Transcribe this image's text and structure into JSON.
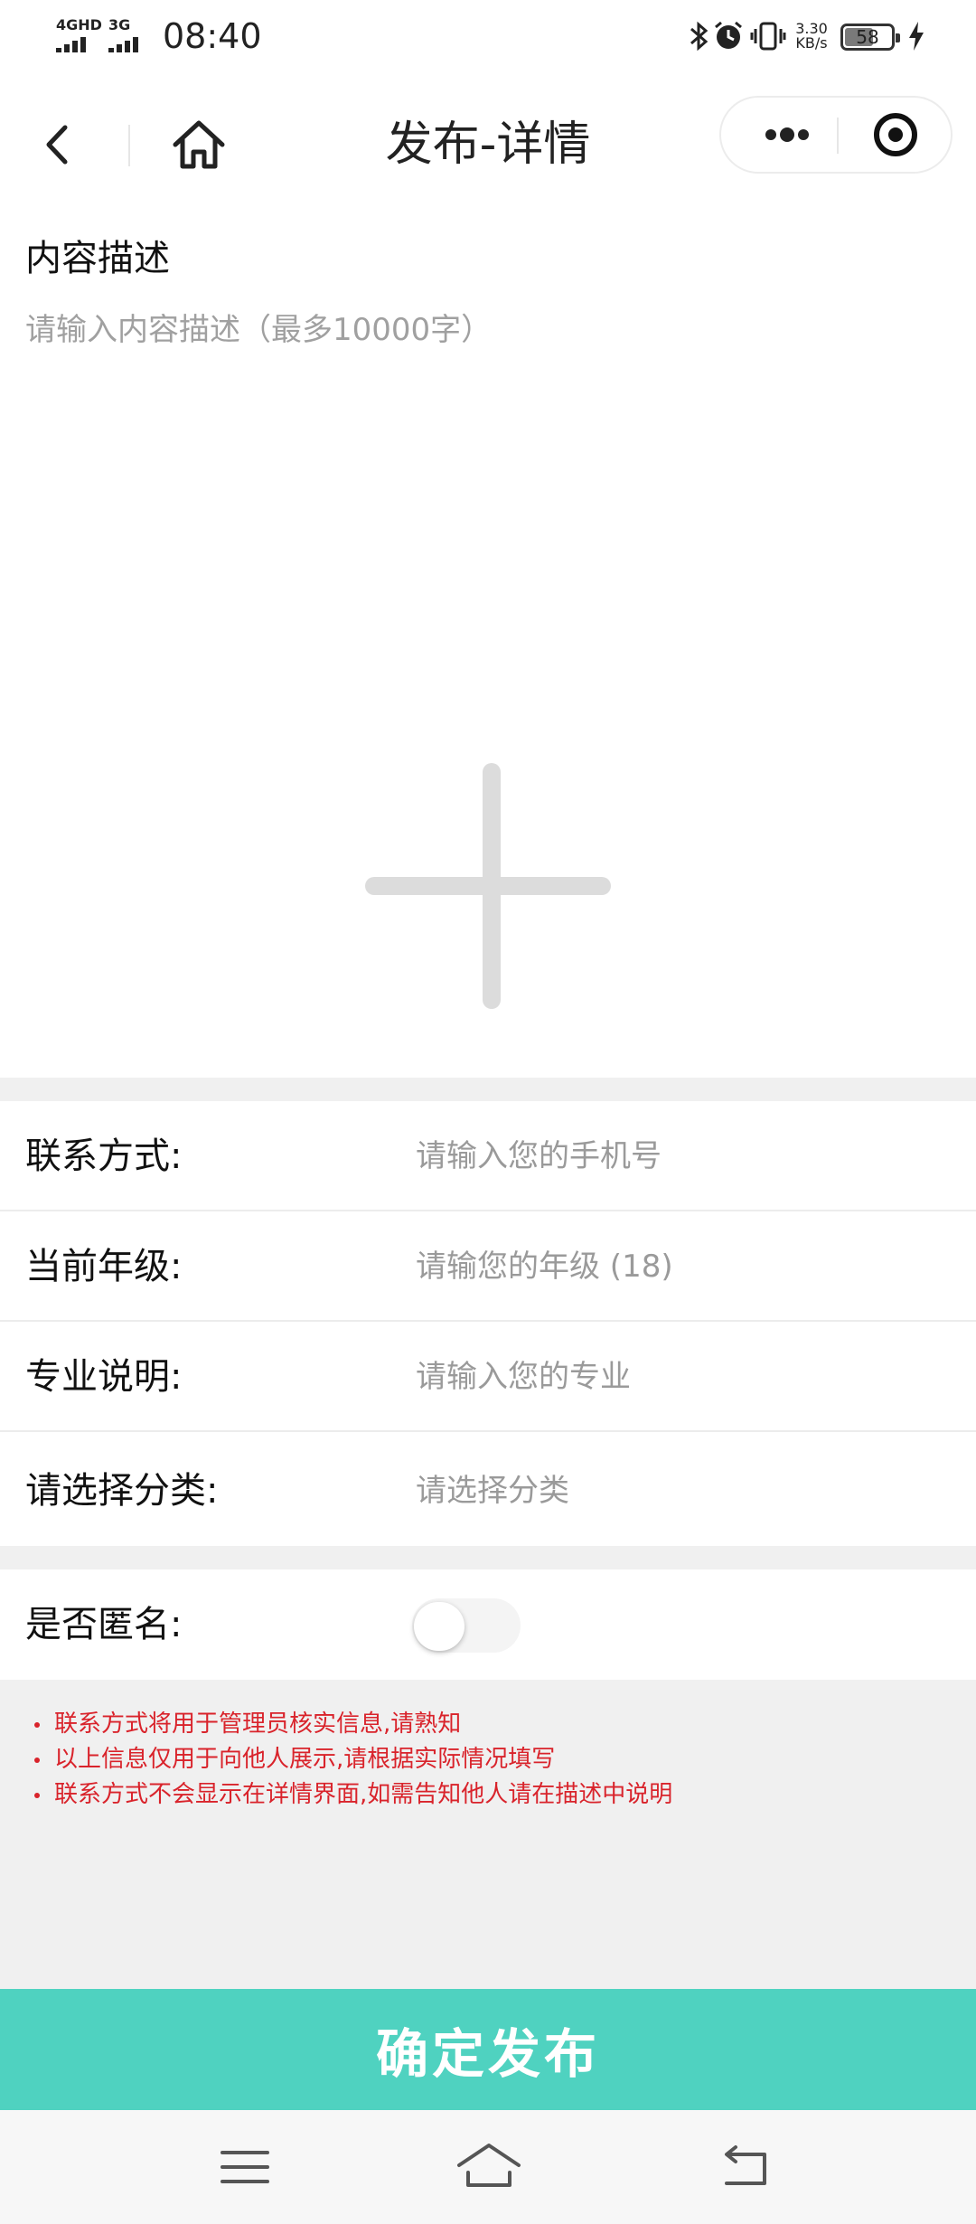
{
  "status_bar": {
    "network_1": "4GHD",
    "network_2": "3G",
    "time": "08:40",
    "speed_value": "3.30",
    "speed_unit": "KB/s",
    "battery_level": "58",
    "battery_fraction": 0.58,
    "icons": [
      "bluetooth-icon",
      "alarm-icon",
      "vibrate-icon",
      "charging-icon"
    ]
  },
  "nav": {
    "title": "发布-详情",
    "icons": [
      "back-icon",
      "home-icon",
      "more-icon",
      "target-icon"
    ]
  },
  "content": {
    "label": "内容描述",
    "placeholder": "请输入内容描述（最多10000字）"
  },
  "form": {
    "contact": {
      "label": "联系方式:",
      "placeholder": "请输入您的手机号"
    },
    "grade": {
      "label": "当前年级:",
      "placeholder": "请输您的年级 (18)"
    },
    "major": {
      "label": "专业说明:",
      "placeholder": "请输入您的专业"
    },
    "category": {
      "label": "请选择分类:",
      "placeholder": "请选择分类"
    },
    "anonymous": {
      "label": "是否匿名:",
      "enabled": false
    }
  },
  "notes": [
    "联系方式将用于管理员核实信息,请熟知",
    "以上信息仅用于向他人展示,请根据实际情况填写",
    "联系方式不会显示在详情界面,如需告知他人请在描述中说明"
  ],
  "submit_label": "确定发布",
  "colors": {
    "accent": "#4fd2c0",
    "note_red": "#d9232b",
    "band_gray": "#f0f0f0",
    "placeholder_gray": "#9a9a9a"
  },
  "system_nav": {
    "icons": [
      "menu-icon",
      "home-icon",
      "back-icon"
    ]
  }
}
